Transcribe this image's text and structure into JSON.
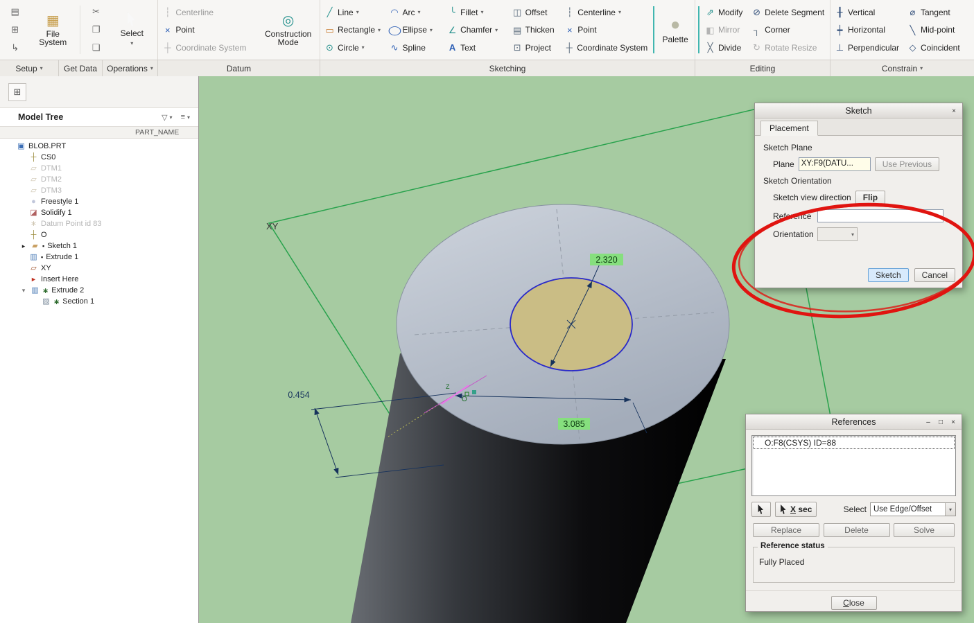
{
  "app": {
    "canvas_bg": "#a6cba1",
    "highlight_green": "#86df7e",
    "dim_color": "#16325c",
    "annotation_red": "#e01410"
  },
  "icons": {
    "caret": "▾",
    "close": "×",
    "minimize": "–",
    "maximize": "□",
    "clipboard": "▤",
    "window": "⊞",
    "export": "↳",
    "file_system": "▦",
    "cut": "✂",
    "copy": "❐",
    "paste": "❏",
    "centerline": "┆",
    "point": "×",
    "csys": "┼",
    "construction": "◎",
    "line": "╱",
    "rectangle": "▭",
    "circle": "⊙",
    "arc": "◠",
    "ellipse": "◯",
    "spline": "∿",
    "fillet": "╰",
    "chamfer": "∠",
    "text": "A",
    "offset": "◫",
    "thicken": "▤",
    "project": "⊡",
    "palette": "●",
    "modify": "⇗",
    "mirror": "◧",
    "divide": "╳",
    "delete_segment": "⊘",
    "corner": "┐",
    "rotate_resize": "↻",
    "vertical": "╂",
    "horizontal": "┿",
    "perpendicular": "⊥",
    "tangent": "⌀",
    "midpoint": "╲",
    "coincident": "◇",
    "tree_toggle": "⊞",
    "funnel": "▽",
    "list_settings": "≡",
    "part": "▣",
    "datum_plane": "▱",
    "freestyle": "●",
    "solidify": "◪",
    "datum_point": "∗",
    "sketch": "▰",
    "extrude": "▥",
    "plane_feature": "▱",
    "insert_here": "►",
    "section": "▨",
    "expander_closed": "▸",
    "expander_open": "▾",
    "marker_modified": "▪",
    "marker_regen": "∗"
  },
  "ribbon": {
    "file_system": "File System",
    "select": "Select",
    "datum": {
      "centerline": "Centerline",
      "point": "Point",
      "csys": "Coordinate System",
      "construction_mode": "Construction Mode"
    },
    "sketching": {
      "line": "Line",
      "rectangle": "Rectangle",
      "circle": "Circle",
      "arc": "Arc",
      "ellipse": "Ellipse",
      "spline": "Spline",
      "fillet": "Fillet",
      "chamfer": "Chamfer",
      "text": "Text",
      "offset": "Offset",
      "thicken": "Thicken",
      "project": "Project",
      "centerline": "Centerline",
      "point": "Point",
      "csys": "Coordinate System",
      "palette": "Palette"
    },
    "editing": {
      "modify": "Modify",
      "mirror": "Mirror",
      "divide": "Divide",
      "delete_segment": "Delete Segment",
      "corner": "Corner",
      "rotate_resize": "Rotate Resize"
    },
    "constrain": {
      "vertical": "Vertical",
      "horizontal": "Horizontal",
      "perpendicular": "Perpendicular",
      "tangent": "Tangent",
      "midpoint": "Mid-point",
      "coincident": "Coincident"
    },
    "tabs": {
      "setup": "Setup",
      "get_data": "Get Data",
      "operations": "Operations",
      "datum": "Datum",
      "sketching": "Sketching",
      "editing": "Editing",
      "constrain": "Constrain"
    }
  },
  "tree": {
    "title": "Model Tree",
    "column": "PART_NAME",
    "items": [
      "BLOB.PRT",
      "CS0",
      "DTM1",
      "DTM2",
      "DTM3",
      "Freestyle 1",
      "Solidify 1",
      "Datum Point id 83",
      "O",
      "Sketch 1",
      "Extrude 1",
      "XY",
      "Insert Here",
      "Extrude 2",
      "Section 1"
    ]
  },
  "canvas": {
    "plane_label": "XY",
    "origin_label": "O",
    "axis_label": "Z",
    "dim_diameter": "2.320",
    "dim_offset": "0.454",
    "dim_distance": "3.085"
  },
  "sketch_dialog": {
    "title": "Sketch",
    "tab_placement": "Placement",
    "section_plane": "Sketch Plane",
    "plane_label": "Plane",
    "plane_value": "XY:F9(DATU...",
    "use_previous": "Use Previous",
    "section_orientation": "Sketch Orientation",
    "view_direction_label": "Sketch view direction",
    "flip": "Flip",
    "reference_label": "Reference",
    "orientation_label": "Orientation",
    "sketch_button": "Sketch",
    "cancel_button": "Cancel"
  },
  "references_dialog": {
    "title": "References",
    "list_item": "O:F8(CSYS) ID=88",
    "xsec_button": "X sec",
    "select_label": "Select",
    "select_value": "Use Edge/Offset",
    "replace_button": "Replace",
    "delete_button": "Delete",
    "solve_button": "Solve",
    "status_group": "Reference status",
    "status_value": "Fully Placed",
    "close_button": "Close"
  }
}
